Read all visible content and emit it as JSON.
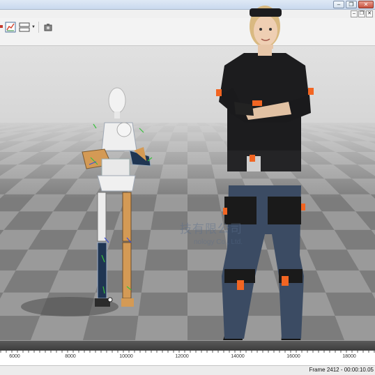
{
  "window": {
    "minimize_glyph": "–",
    "restore_glyph": "❐",
    "close_glyph": "✕",
    "mdi_minimize_glyph": "–",
    "mdi_restore_glyph": "❐",
    "mdi_close_glyph": "✕"
  },
  "toolbar": {
    "tools": [
      "record-icon",
      "graph-editor-icon",
      "layout-icon",
      "dropdown-caret-icon",
      "camera-icon"
    ]
  },
  "watermark": {
    "cn": "技有限公司",
    "en": "nology Co., Ltd."
  },
  "timeline": {
    "ticks": [
      "6000",
      "8000",
      "10000",
      "12000",
      "14000",
      "16000",
      "18000"
    ]
  },
  "status": {
    "frame_readout": "Frame 2412 - 00:00:10.05"
  },
  "colors": {
    "suit": "#1c1c1e",
    "sensor": "#f26522",
    "jeans": "#3b4b63",
    "skeleton_gold": "#d49a55",
    "skeleton_blue": "#1f3552"
  }
}
